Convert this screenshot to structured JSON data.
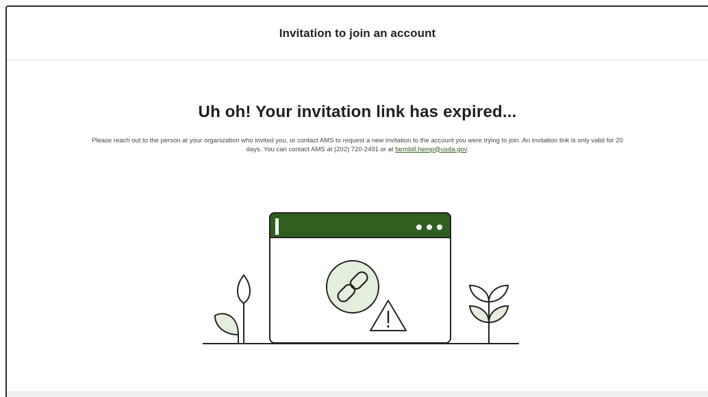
{
  "dialog": {
    "title": "Invitation to join an account"
  },
  "main": {
    "headline": "Uh oh! Your invitation link has expired...",
    "message_lead": "Please reach out to the person at your organization who invited you, or contact AMS to request a new invitation to the account you were trying to join. An invitation link is only valid for 20 days. You can contact AMS at (202) 720-2491 or at ",
    "email_link": "farmbill.hemp@usda.gov",
    "message_tail": "."
  },
  "illustration": {
    "icons": [
      "plant-sprout-icon",
      "browser-window-icon",
      "broken-link-icon",
      "warning-triangle-icon",
      "leafy-plant-icon"
    ],
    "colors": {
      "accent_green": "#2f5f1e",
      "light_green": "#e4eedd",
      "stroke": "#222222"
    }
  }
}
